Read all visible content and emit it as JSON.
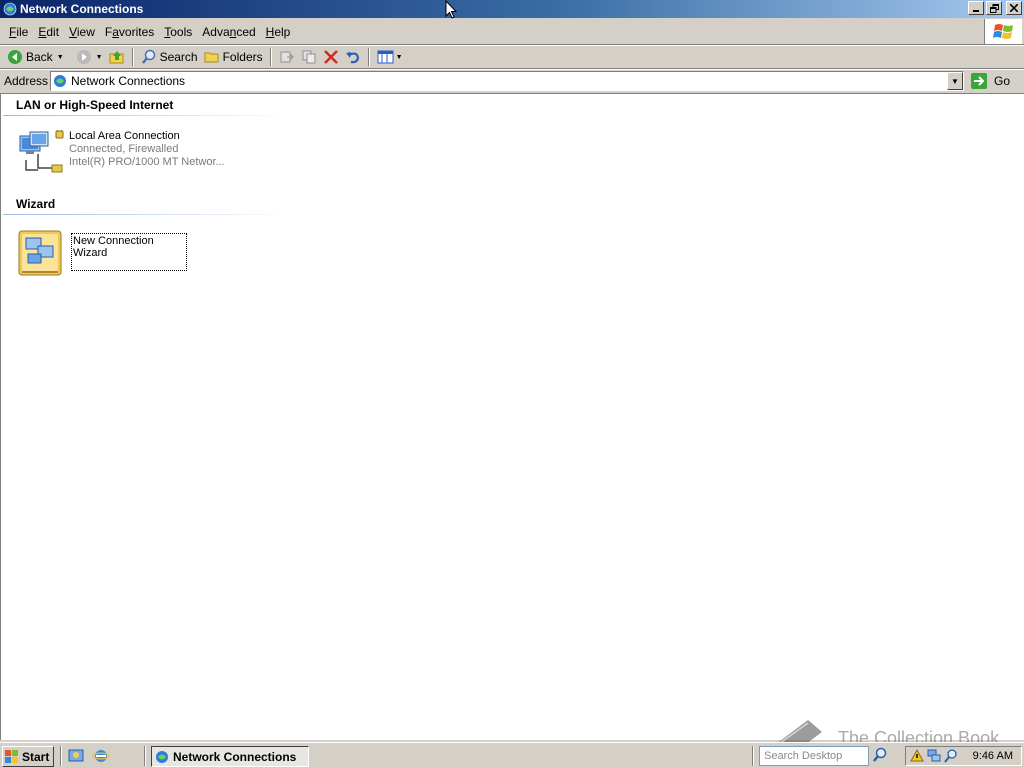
{
  "window": {
    "title": "Network Connections",
    "caption_buttons": [
      "minimize",
      "restore",
      "close"
    ]
  },
  "menubar": {
    "items": [
      {
        "label": "File",
        "accel": "F"
      },
      {
        "label": "Edit",
        "accel": "E"
      },
      {
        "label": "View",
        "accel": "V"
      },
      {
        "label": "Favorites",
        "accel": "a"
      },
      {
        "label": "Tools",
        "accel": "T"
      },
      {
        "label": "Advanced",
        "accel": "n"
      },
      {
        "label": "Help",
        "accel": "H"
      }
    ]
  },
  "toolbar": {
    "back_label": "Back",
    "search_label": "Search",
    "folders_label": "Folders"
  },
  "address": {
    "label": "Address",
    "value": "Network Connections",
    "go_label": "Go"
  },
  "groups": [
    {
      "header": "LAN or High-Speed Internet",
      "items": [
        {
          "name": "Local Area Connection",
          "status": "Connected, Firewalled",
          "device": "Intel(R) PRO/1000 MT Networ..."
        }
      ]
    },
    {
      "header": "Wizard",
      "items": [
        {
          "name": "New Connection Wizard"
        }
      ]
    }
  ],
  "taskbar": {
    "start_label": "Start",
    "task_label": "Network Connections",
    "search_placeholder": "Search Desktop",
    "clock": "9:46 AM"
  },
  "watermark": {
    "text": "The Collection Book"
  },
  "colors": {
    "title_gradient_start": "#0a246a",
    "title_gradient_end": "#a6caf0",
    "face": "#d4d0c8",
    "content_bg": "#ffffff",
    "subtext": "#7a7a7a"
  }
}
